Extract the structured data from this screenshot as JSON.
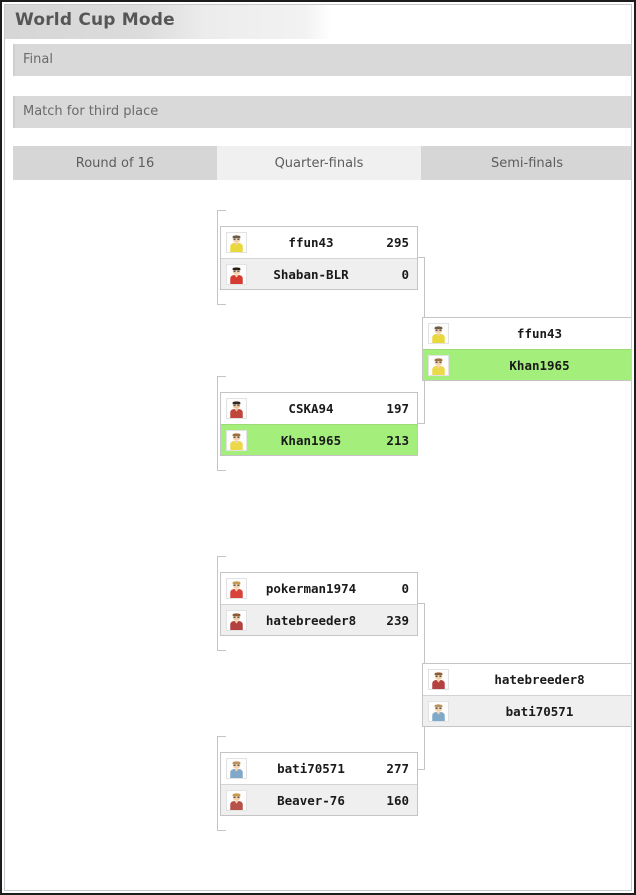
{
  "window": {
    "title": "World Cup Mode"
  },
  "sections": [
    {
      "id": "final",
      "label": "Final"
    },
    {
      "id": "third",
      "label": "Match for third place"
    }
  ],
  "tabs": [
    {
      "label": "Round of 16",
      "selected": false
    },
    {
      "label": "Quarter-finals",
      "selected": true
    },
    {
      "label": "Semi-finals",
      "selected": false
    }
  ],
  "colors": {
    "winner_highlight": "#a4ee7c",
    "row_alt": "#efefef",
    "bar": "#d9d9d9",
    "tab_bar": "#d6d6d6",
    "tab_selected": "#f0f0f0",
    "border": "#c4c4c4",
    "text": "#1a1a1a",
    "label_text": "#6b6b6b"
  },
  "bracket": {
    "round_of_16": [
      {
        "players": [
          {
            "name": "ffun43",
            "score": "295",
            "winner": false,
            "avatar": "avatar-icon-ffun43",
            "shirt": "#e8d83c",
            "hair": "#6b5b4a",
            "skin": "#f2cfa8"
          },
          {
            "name": "Shaban-BLR",
            "score": "0",
            "winner": false,
            "avatar": "avatar-icon-shaban-blr",
            "shirt": "#d63b33",
            "hair": "#23201d",
            "skin": "#f2cfa8"
          }
        ]
      },
      {
        "players": [
          {
            "name": "CSKA94",
            "score": "197",
            "winner": false,
            "avatar": "avatar-icon-cska94",
            "shirt": "#c0453d",
            "hair": "#2c2722",
            "skin": "#edc49c"
          },
          {
            "name": "Khan1965",
            "score": "213",
            "winner": true,
            "avatar": "avatar-icon-khan1965",
            "shirt": "#ecd94a",
            "hair": "#9b6f3e",
            "skin": "#f3d2ac"
          }
        ]
      },
      {
        "players": [
          {
            "name": "pokerman1974",
            "score": "0",
            "winner": false,
            "avatar": "avatar-icon-pokerman1974",
            "shirt": "#d8423a",
            "hair": "#c69a52",
            "skin": "#f4d4ae"
          },
          {
            "name": "hatebreeder8",
            "score": "239",
            "winner": false,
            "avatar": "avatar-icon-hatebreeder8",
            "shirt": "#b2413f",
            "hair": "#8d5a36",
            "skin": "#f1d0a8"
          }
        ]
      },
      {
        "players": [
          {
            "name": "bati70571",
            "score": "277",
            "winner": false,
            "avatar": "avatar-icon-bati70571",
            "shirt": "#7fa8c9",
            "hair": "#b9935f",
            "skin": "#f3d3ad"
          },
          {
            "name": "Beaver-76",
            "score": "160",
            "winner": false,
            "avatar": "avatar-icon-beaver-76",
            "shirt": "#b8504a",
            "hair": "#c79a4e",
            "skin": "#f3d2ab"
          }
        ]
      }
    ],
    "quarter_finals": [
      {
        "players": [
          {
            "name": "ffun43",
            "score": "",
            "winner": false,
            "avatar": "avatar-icon-ffun43",
            "shirt": "#e8d83c",
            "hair": "#6b5b4a",
            "skin": "#f2cfa8"
          },
          {
            "name": "Khan1965",
            "score": "",
            "winner": true,
            "avatar": "avatar-icon-khan1965",
            "shirt": "#ecd94a",
            "hair": "#9b6f3e",
            "skin": "#f3d2ac"
          }
        ]
      },
      {
        "players": [
          {
            "name": "hatebreeder8",
            "score": "",
            "winner": false,
            "avatar": "avatar-icon-hatebreeder8",
            "shirt": "#b2413f",
            "hair": "#8d5a36",
            "skin": "#f1d0a8"
          },
          {
            "name": "bati70571",
            "score": "",
            "winner": false,
            "avatar": "avatar-icon-bati70571",
            "shirt": "#7fa8c9",
            "hair": "#b9935f",
            "skin": "#f3d3ad"
          }
        ]
      }
    ]
  }
}
